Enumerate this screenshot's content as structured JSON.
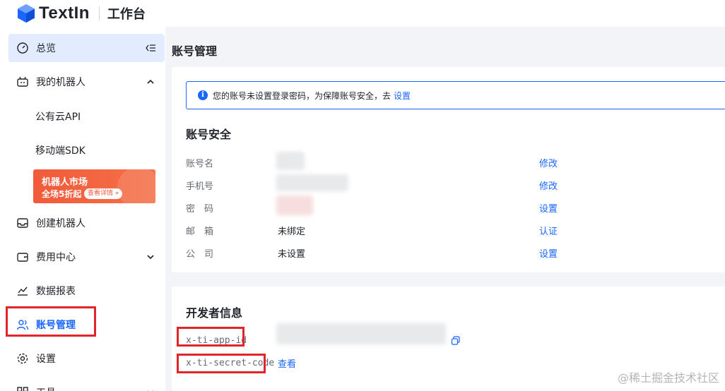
{
  "header": {
    "brand": "TextIn",
    "workspace": "工作台"
  },
  "sidebar": {
    "overview": "总览",
    "my_robots": "我的机器人",
    "sub_items": [
      "公有云API",
      "移动端SDK"
    ],
    "promo": {
      "line1": "机器人市场",
      "line2": "全场5折起",
      "button": "查看详情 »"
    },
    "create_robot": "创建机器人",
    "billing": "费用中心",
    "reports": "数据报表",
    "account": "账号管理",
    "settings": "设置",
    "tools": "工具"
  },
  "main": {
    "page_title": "账号管理",
    "notice": {
      "text": "您的账号未设置登录密码，为保障账号安全，去",
      "link": "设置"
    },
    "security": {
      "title": "账号安全",
      "rows": [
        {
          "label": "账号名",
          "value": "",
          "action": "修改"
        },
        {
          "label": "手机号",
          "value": "",
          "action": "修改"
        },
        {
          "label": "密　码",
          "value": "",
          "action": "设置"
        },
        {
          "label": "邮　箱",
          "value": "未绑定",
          "action": "认证"
        },
        {
          "label": "公　司",
          "value": "未设置",
          "action": "设置"
        }
      ]
    },
    "developer": {
      "title": "开发者信息",
      "app_id_label": "x-ti-app-id",
      "secret_label": "x-ti-secret-code",
      "view_link": "查看"
    }
  },
  "watermark": "@稀土掘金技术社区",
  "colors": {
    "accent": "#1a66ff",
    "highlight": "#e0262b",
    "promo": "#f25a3a"
  }
}
